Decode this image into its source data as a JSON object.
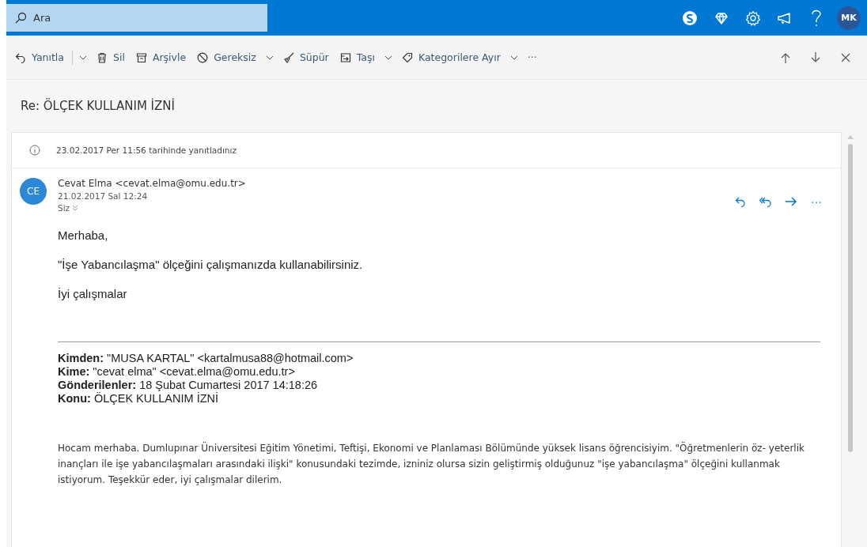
{
  "topbar": {
    "search": {
      "placeholder": "Ara"
    },
    "avatar": "MK"
  },
  "toolbar": {
    "items": [
      {
        "kind": "reply",
        "label": "Yanıtla",
        "dropdown": true,
        "split": true
      },
      {
        "kind": "delete",
        "label": "Sil",
        "dropdown": false
      },
      {
        "kind": "archive",
        "label": "Arşivle",
        "dropdown": false
      },
      {
        "kind": "junk",
        "label": "Gereksiz",
        "dropdown": true
      },
      {
        "kind": "sweep",
        "label": "Süpür",
        "dropdown": false
      },
      {
        "kind": "move",
        "label": "Taşı",
        "dropdown": true
      },
      {
        "kind": "categorize",
        "label": "Kategorilere Ayır",
        "dropdown": true
      }
    ],
    "more": "···"
  },
  "subject": "Re: ÖLÇEK KULLANIM İZNİ",
  "info": "23.02.2017 Per 11:56 tarihinde yanıtladınız",
  "message": {
    "initials": "CE",
    "sender": "Cevat Elma <cevat.elma@omu.edu.tr>",
    "date": "21.02.2017 Sal 12:24",
    "to": "Siz",
    "more": "···",
    "body": [
      "Merhaba,",
      "\"İşe Yabancılaşma\" ölçeğini çalışmanızda kullanabilirsiniz.",
      "İyi çalışmalar"
    ],
    "quoted_headers": [
      "**Kimden:** \"MUSA KARTAL\" <kartalmusa88@hotmail.com>",
      "**Kime:** \"cevat elma\" <cevat.elma@omu.edu.tr>",
      "**Gönderilenler:** 18 Şubat Cumartesi 2017 14:18:26",
      "**Konu:** ÖLÇEK KULLANIM İZNİ"
    ],
    "quoted_text": "Hocam merhaba. Dumlupınar Üniversitesi Eğitim Yönetimi, Teftişi, Ekonomi ve Planlaması Bölümünde yüksek lisans öğrencisiyim. \"Öğretmenlerin öz- yeterlik inançları ile işe yabancılaşmaları arasındaki ilişki\" konusundaki tezimde, izniniz olursa sizin geliştirmiş olduğunuz \"işe yabancılaşma\" ölçeğini kullanmak istiyorum. Teşekkür eder, iyi çalışmalar dilerim."
  }
}
